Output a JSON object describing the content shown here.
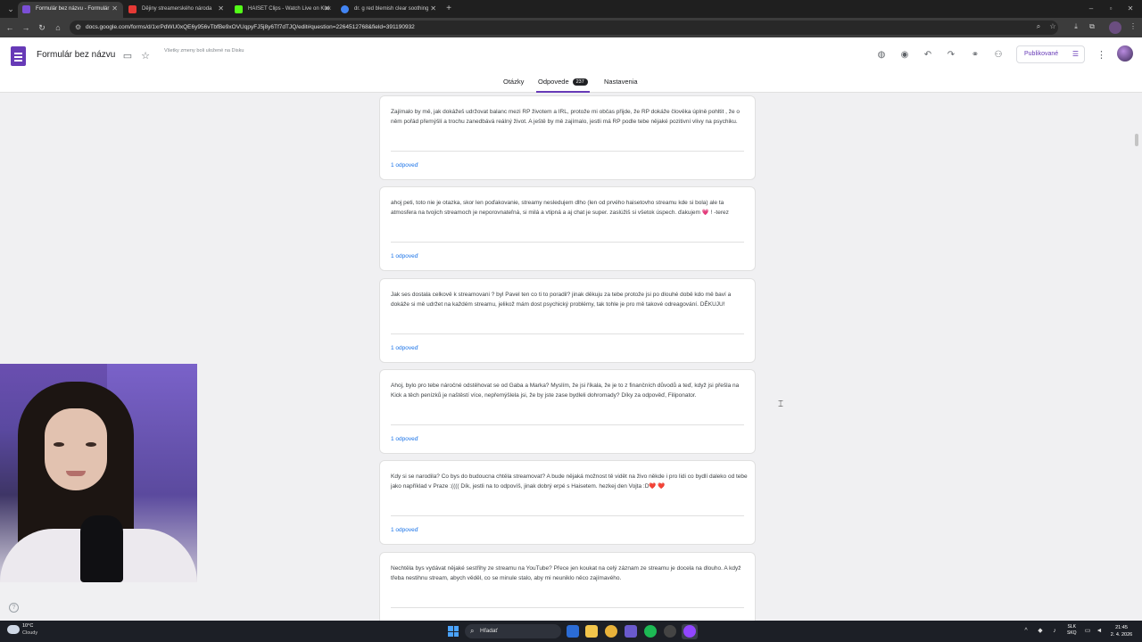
{
  "browser": {
    "tabs": [
      {
        "title": "Formulár bez názvu - Formulár",
        "active": true,
        "favicon_color": "#7b4fd6"
      },
      {
        "title": "Dějiny streamerského národa",
        "active": false,
        "favicon_color": "#e53935"
      },
      {
        "title": "HAISET Clips - Watch Live on Kick",
        "active": false,
        "favicon_color": "#53fc18"
      },
      {
        "title": "dr. g red blemish clear soothing",
        "active": false,
        "favicon_color": "#4285f4"
      }
    ],
    "url": "docs.google.com/forms/d/1xrPdWU0xQE6y956vTbfBe9xOVUqpyFJ5j8y6Tf7dTJQ/edit#question=2264512768&field=391190932"
  },
  "form": {
    "title": "Formulár bez názvu",
    "save_status": "Všetky zmeny boli uložené na Disku",
    "publish_label": "Publikované",
    "tabs": [
      {
        "label": "Otázky"
      },
      {
        "label": "Odpovede",
        "count": "237"
      },
      {
        "label": "Nastavenia"
      }
    ]
  },
  "responses": [
    {
      "text": "Zajímalo by mě, jak dokážeš udržovat balanc mezi RP životem a IRL, protože mi občas přijde, že RP dokáže člověka úplně pohltit , že o něm pořád přemýšlí a trochu zanedbává reálný život. A ještě by mě zajímalo, jestli má RP podle tebe nějaké pozitivní vlivy na psychiku.",
      "reply": "1 odpoveď"
    },
    {
      "text": "ahoj peti, toto nie je otazka, skor len poďakovanie, streamy nesledujem dlho (len od prvého haisetovho streamu kde si bola) ale ta atmosfera na tvojich streamoch je neporovnateľná, si milá a vtipná a aj chat je super. zaslúžiš si všetok úspech. ďakujem 💗 ! -terez",
      "reply": "1 odpoveď"
    },
    {
      "text": "Jak ses dostala celkově k streamovani ? byl Pavel ten co ti to poradil? jinak děkuju za tebe protože jsi po dlouhé době kdo mě baví a dokáže si mě udržet na každém streamu, jelikož mám dost psychický problémy, tak tohle je pro mě takové odreagování. DĚKUJU!",
      "reply": "1 odpoveď"
    },
    {
      "text": "Ahoj, bylo pro tebe náročné odstěhovat se od Gaba a Marka? Myslím, že jsi říkala, že je to z finančních důvodů a teď, když jsi přešla na Kick a těch penízků je naštěstí více, nepřemýšlela jsi, že by jste zase bydleli dohromady? Díky za odpověď, Filiponator.",
      "reply": "1 odpoveď"
    },
    {
      "text": "Kdy si se narodila? Co bys do budoucna chtěla streamovat? A bude nějaká možnost tě vidět na živo někde i pro lidi co bydlí daleko od tebe jako například v Praze :(((( Dík, jestli na to odpovíš, jinak dobrý erpé s Haisetem. hezkej den Vojta :D❤️ ❤️",
      "reply": "1 odpoveď"
    },
    {
      "text": "Nechtěla bys vydávat nějaké sestřihy ze streamu na YouTube? Přece jen koukat na celý záznam ze streamu je docela na dlouho. A když třeba nestihnu stream, abych věděl, co se minule stalo, aby mi neuniklo něco zajímavého.",
      "reply": ""
    }
  ],
  "taskbar": {
    "weather_temp": "10°C",
    "weather_cond": "Cloudy",
    "search_label": "Hľadať",
    "lang_line1": "SLK",
    "lang_line2": "SKQ",
    "time": "21:45",
    "date": "2. 4. 2026"
  }
}
